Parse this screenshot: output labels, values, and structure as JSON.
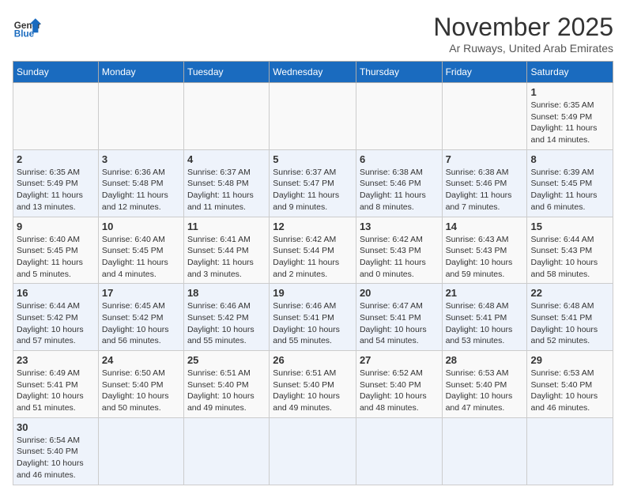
{
  "header": {
    "logo_general": "General",
    "logo_blue": "Blue",
    "title": "November 2025",
    "subtitle": "Ar Ruways, United Arab Emirates"
  },
  "weekdays": [
    "Sunday",
    "Monday",
    "Tuesday",
    "Wednesday",
    "Thursday",
    "Friday",
    "Saturday"
  ],
  "weeks": [
    [
      {
        "day": "",
        "info": ""
      },
      {
        "day": "",
        "info": ""
      },
      {
        "day": "",
        "info": ""
      },
      {
        "day": "",
        "info": ""
      },
      {
        "day": "",
        "info": ""
      },
      {
        "day": "",
        "info": ""
      },
      {
        "day": "1",
        "info": "Sunrise: 6:35 AM\nSunset: 5:49 PM\nDaylight: 11 hours and 14 minutes."
      }
    ],
    [
      {
        "day": "2",
        "info": "Sunrise: 6:35 AM\nSunset: 5:49 PM\nDaylight: 11 hours and 13 minutes."
      },
      {
        "day": "3",
        "info": "Sunrise: 6:36 AM\nSunset: 5:48 PM\nDaylight: 11 hours and 12 minutes."
      },
      {
        "day": "4",
        "info": "Sunrise: 6:37 AM\nSunset: 5:48 PM\nDaylight: 11 hours and 11 minutes."
      },
      {
        "day": "5",
        "info": "Sunrise: 6:37 AM\nSunset: 5:47 PM\nDaylight: 11 hours and 9 minutes."
      },
      {
        "day": "6",
        "info": "Sunrise: 6:38 AM\nSunset: 5:46 PM\nDaylight: 11 hours and 8 minutes."
      },
      {
        "day": "7",
        "info": "Sunrise: 6:38 AM\nSunset: 5:46 PM\nDaylight: 11 hours and 7 minutes."
      },
      {
        "day": "8",
        "info": "Sunrise: 6:39 AM\nSunset: 5:45 PM\nDaylight: 11 hours and 6 minutes."
      }
    ],
    [
      {
        "day": "9",
        "info": "Sunrise: 6:40 AM\nSunset: 5:45 PM\nDaylight: 11 hours and 5 minutes."
      },
      {
        "day": "10",
        "info": "Sunrise: 6:40 AM\nSunset: 5:45 PM\nDaylight: 11 hours and 4 minutes."
      },
      {
        "day": "11",
        "info": "Sunrise: 6:41 AM\nSunset: 5:44 PM\nDaylight: 11 hours and 3 minutes."
      },
      {
        "day": "12",
        "info": "Sunrise: 6:42 AM\nSunset: 5:44 PM\nDaylight: 11 hours and 2 minutes."
      },
      {
        "day": "13",
        "info": "Sunrise: 6:42 AM\nSunset: 5:43 PM\nDaylight: 11 hours and 0 minutes."
      },
      {
        "day": "14",
        "info": "Sunrise: 6:43 AM\nSunset: 5:43 PM\nDaylight: 10 hours and 59 minutes."
      },
      {
        "day": "15",
        "info": "Sunrise: 6:44 AM\nSunset: 5:43 PM\nDaylight: 10 hours and 58 minutes."
      }
    ],
    [
      {
        "day": "16",
        "info": "Sunrise: 6:44 AM\nSunset: 5:42 PM\nDaylight: 10 hours and 57 minutes."
      },
      {
        "day": "17",
        "info": "Sunrise: 6:45 AM\nSunset: 5:42 PM\nDaylight: 10 hours and 56 minutes."
      },
      {
        "day": "18",
        "info": "Sunrise: 6:46 AM\nSunset: 5:42 PM\nDaylight: 10 hours and 55 minutes."
      },
      {
        "day": "19",
        "info": "Sunrise: 6:46 AM\nSunset: 5:41 PM\nDaylight: 10 hours and 55 minutes."
      },
      {
        "day": "20",
        "info": "Sunrise: 6:47 AM\nSunset: 5:41 PM\nDaylight: 10 hours and 54 minutes."
      },
      {
        "day": "21",
        "info": "Sunrise: 6:48 AM\nSunset: 5:41 PM\nDaylight: 10 hours and 53 minutes."
      },
      {
        "day": "22",
        "info": "Sunrise: 6:48 AM\nSunset: 5:41 PM\nDaylight: 10 hours and 52 minutes."
      }
    ],
    [
      {
        "day": "23",
        "info": "Sunrise: 6:49 AM\nSunset: 5:41 PM\nDaylight: 10 hours and 51 minutes."
      },
      {
        "day": "24",
        "info": "Sunrise: 6:50 AM\nSunset: 5:40 PM\nDaylight: 10 hours and 50 minutes."
      },
      {
        "day": "25",
        "info": "Sunrise: 6:51 AM\nSunset: 5:40 PM\nDaylight: 10 hours and 49 minutes."
      },
      {
        "day": "26",
        "info": "Sunrise: 6:51 AM\nSunset: 5:40 PM\nDaylight: 10 hours and 49 minutes."
      },
      {
        "day": "27",
        "info": "Sunrise: 6:52 AM\nSunset: 5:40 PM\nDaylight: 10 hours and 48 minutes."
      },
      {
        "day": "28",
        "info": "Sunrise: 6:53 AM\nSunset: 5:40 PM\nDaylight: 10 hours and 47 minutes."
      },
      {
        "day": "29",
        "info": "Sunrise: 6:53 AM\nSunset: 5:40 PM\nDaylight: 10 hours and 46 minutes."
      }
    ],
    [
      {
        "day": "30",
        "info": "Sunrise: 6:54 AM\nSunset: 5:40 PM\nDaylight: 10 hours and 46 minutes."
      },
      {
        "day": "",
        "info": ""
      },
      {
        "day": "",
        "info": ""
      },
      {
        "day": "",
        "info": ""
      },
      {
        "day": "",
        "info": ""
      },
      {
        "day": "",
        "info": ""
      },
      {
        "day": "",
        "info": ""
      }
    ]
  ]
}
